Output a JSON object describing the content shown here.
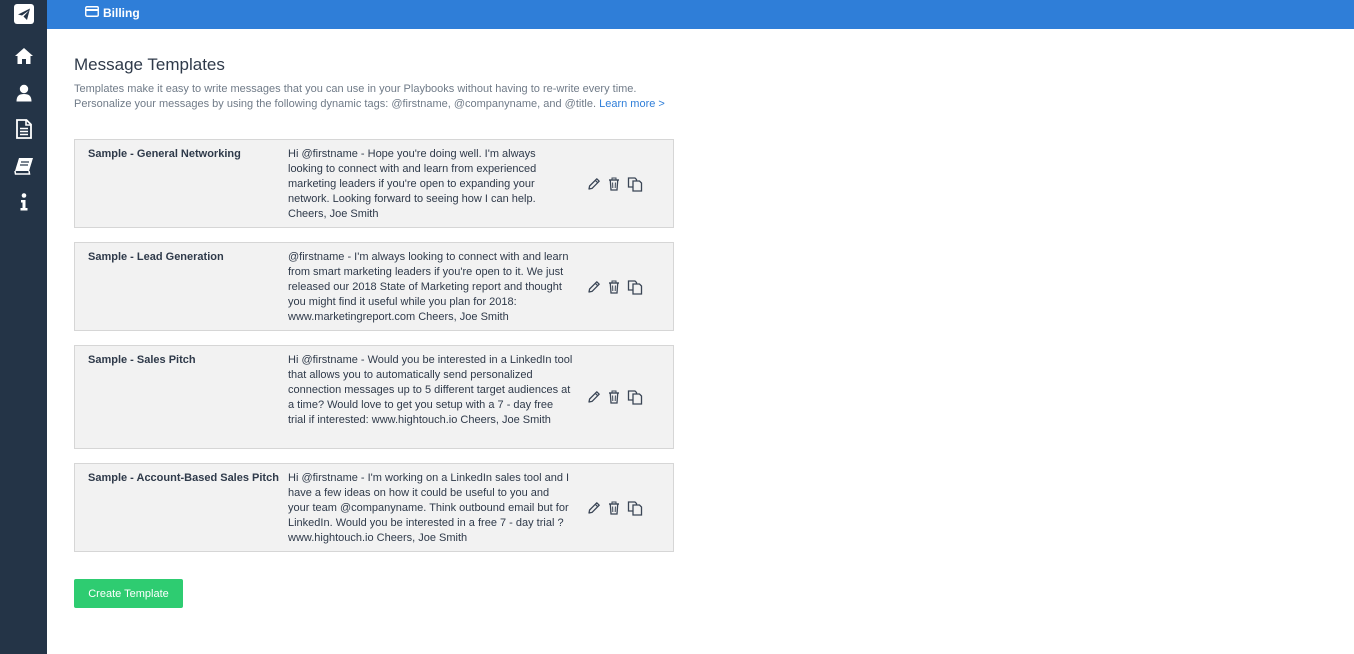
{
  "topbar": {
    "billing": {
      "label": "Billing",
      "icon": "credit-card-icon"
    }
  },
  "sidebar": {
    "items": [
      {
        "icon": "paper-plane-icon"
      },
      {
        "icon": "home-icon"
      },
      {
        "icon": "user-icon"
      },
      {
        "icon": "document-icon"
      },
      {
        "icon": "book-icon"
      },
      {
        "icon": "info-icon"
      }
    ]
  },
  "page": {
    "title": "Message Templates",
    "intro_line1": "Templates make it easy to write messages that you can use in your Playbooks without having to re-write every time.",
    "intro_line2": "Personalize your messages by using the following dynamic tags: @firstname, @companyname, and @title.",
    "learn_more": "Learn more >"
  },
  "templates": [
    {
      "name": "Sample - General Networking",
      "message": "Hi @firstname - Hope you're doing well. I'm always looking to connect with and learn from experienced marketing leaders if you're open to expanding your network. Looking forward to seeing how I can help. Cheers, Joe Smith"
    },
    {
      "name": "Sample - Lead Generation",
      "message": "@firstname - I'm always looking to connect with and learn from smart marketing leaders if you're open to it. We just released our 2018 State of Marketing report and thought you might find it useful while you plan for 2018: www.marketingreport.com Cheers, Joe Smith"
    },
    {
      "name": "Sample - Sales Pitch",
      "message": "Hi @firstname - Would you be interested in a LinkedIn tool that allows you to automatically send personalized connection messages up to 5 different target audiences at a time? Would love to get you setup with a 7 - day free trial if interested: www.hightouch.io Cheers, Joe Smith"
    },
    {
      "name": "Sample - Account-Based Sales Pitch",
      "message": "Hi @firstname - I'm working on a LinkedIn sales tool and I have a few ideas on how it could be useful to you and your team @companyname. Think outbound email but for LinkedIn. Would you be interested in a free 7 - day trial ? www.hightouch.io Cheers, Joe Smith"
    }
  ],
  "actions": {
    "create_label": "Create Template"
  },
  "colors": {
    "sidebar": "#243447",
    "topbar": "#2f7ed8",
    "accent_button": "#2ecc71",
    "card_bg": "#f2f2f2"
  }
}
